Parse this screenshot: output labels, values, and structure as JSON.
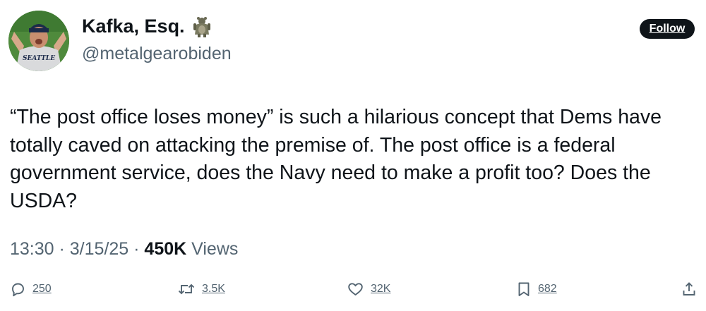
{
  "author": {
    "display_name": "Kafka, Esq.",
    "handle": "@metalgearobiden",
    "avatar_jersey_text": "SEATTLE",
    "name_emoji": "hugging-teddy-figure-icon"
  },
  "follow_label": "Follow",
  "tweet": {
    "lines": [
      "“The post office loses money” is such a hilarious concept that Dems have",
      "totally caved on attacking the premise of. The post office is a federal",
      "government service, does the Navy need to make a profit too? Does the",
      "USDA?"
    ]
  },
  "meta": {
    "time": "13:30",
    "sep1": " · ",
    "date": "3/15/25",
    "sep2": " · ",
    "views_count": "450K",
    "views_label": " Views"
  },
  "actions": {
    "replies": "250",
    "reposts": "3.5K",
    "likes": "32K",
    "bookmarks": "682"
  },
  "colors": {
    "text": "#0f1419",
    "secondary": "#536471",
    "button_bg": "#0f1419"
  }
}
